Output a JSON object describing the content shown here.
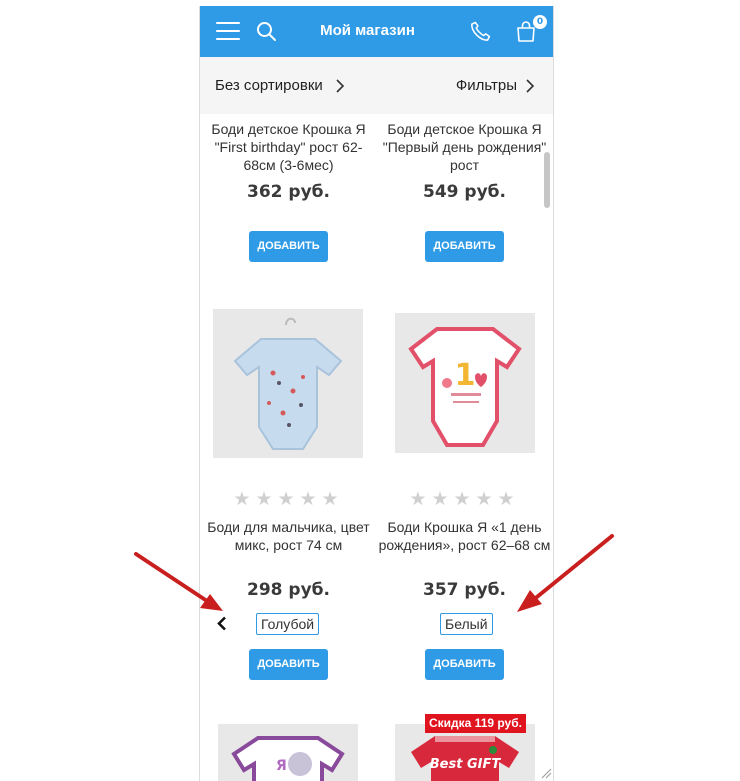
{
  "header": {
    "title": "Мой магазин",
    "cart_count": "0"
  },
  "toolbar": {
    "sort_label": "Без сортировки",
    "filter_label": "Фильтры"
  },
  "products": [
    {
      "name": "Боди детское Крошка Я \"First birthday\" рост 62-68см (3-6мес)",
      "price": "362 руб.",
      "button": "ДОБАВИТЬ"
    },
    {
      "name": "Боди детское Крошка Я \"Первый день рождения\" рост",
      "price": "549 руб.",
      "button": "ДОБАВИТЬ"
    },
    {
      "name": "Боди для мальчика, цвет микс, рост 74 см",
      "price": "298 руб.",
      "button": "ДОБАВИТЬ",
      "variant": "Голубой",
      "rating": 0
    },
    {
      "name": "Боди Крошка Я «1 день рождения», рост 62–68 см",
      "price": "357 руб.",
      "button": "ДОБАВИТЬ",
      "variant": "Белый",
      "rating": 0
    },
    {
      "sale_badge": "Скидка 119 руб.",
      "image_text": "Best GIFT"
    }
  ],
  "colors": {
    "accent": "#2f9ae6",
    "sale": "#e0141e",
    "annotation_arrow": "#c9201f"
  }
}
